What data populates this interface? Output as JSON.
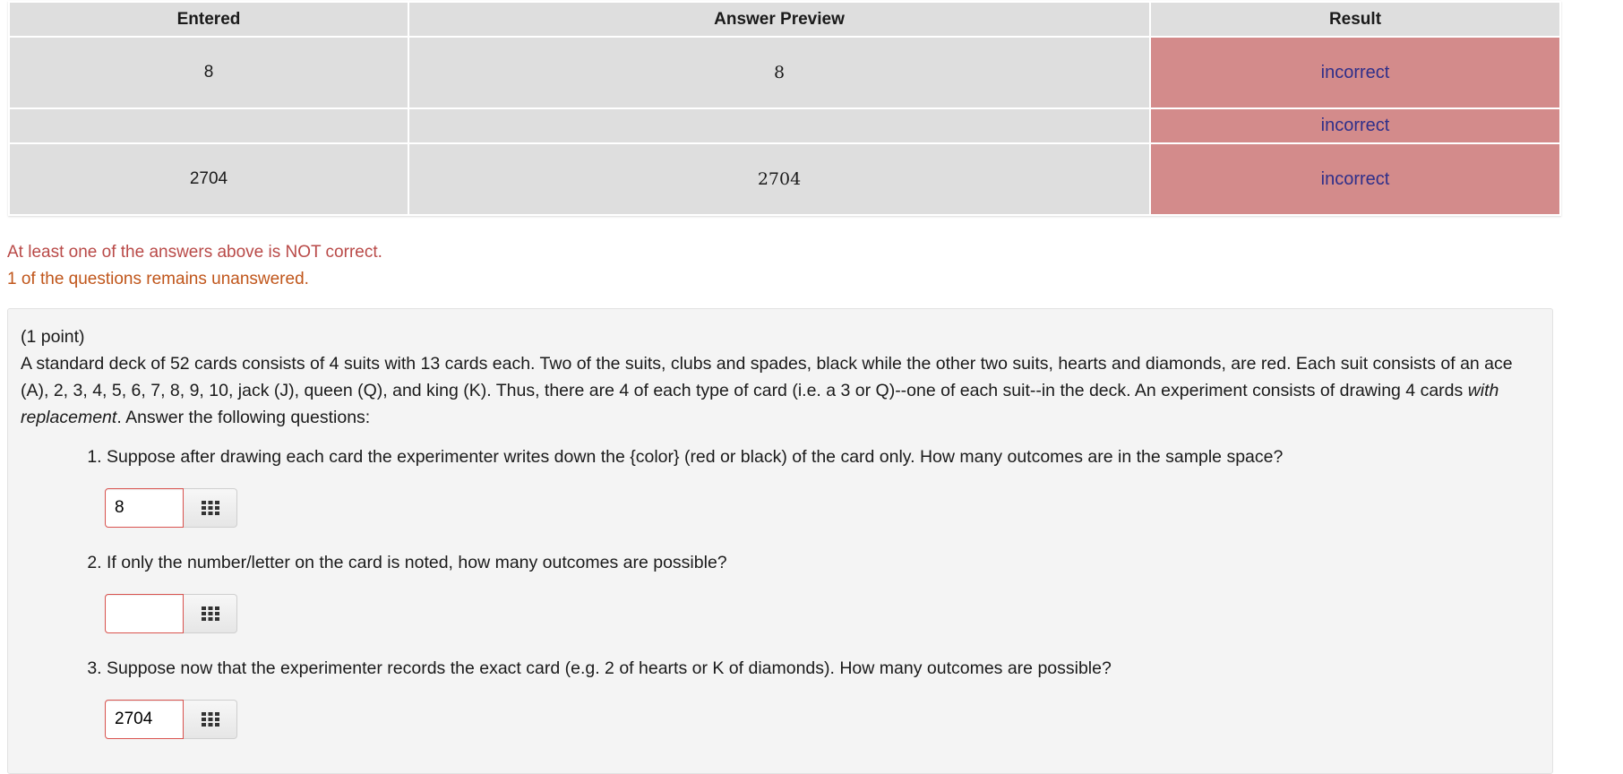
{
  "table": {
    "headers": [
      "Entered",
      "Answer Preview",
      "Result"
    ],
    "rows": [
      {
        "entered": "8",
        "preview": "8",
        "result": "incorrect"
      },
      {
        "entered": "",
        "preview": "",
        "result": "incorrect"
      },
      {
        "entered": "2704",
        "preview": "2704",
        "result": "incorrect"
      }
    ]
  },
  "messages": {
    "error": "At least one of the answers above is NOT correct.",
    "warning": "1 of the questions remains unanswered."
  },
  "problem": {
    "points": "(1 point)",
    "intro_before_em": "A standard deck of 52 cards consists of 4 suits with 13 cards each. Two of the suits, clubs and spades, black while the other two suits, hearts and diamonds, are red. Each suit consists of an ace (A), 2, 3, 4, 5, 6, 7, 8, 9, 10, jack (J), queen (Q), and king (K). Thus, there are 4 of each type of card (i.e. a 3 or Q)--one of each suit--in the deck. An experiment consists of drawing 4 cards ",
    "intro_em": "with replacement",
    "intro_after_em": ". Answer the following questions:",
    "questions": [
      {
        "text": "Suppose after drawing each card the experimenter writes down the {color} (red or black) of the card only. How many outcomes are in the sample space?",
        "value": "8"
      },
      {
        "text": "If only the number/letter on the card is noted, how many outcomes are possible?",
        "value": ""
      },
      {
        "text": "Suppose now that the experimenter records the exact card (e.g. 2 of hearts or K of diamonds). How many outcomes are possible?",
        "value": "2704"
      }
    ]
  },
  "colors": {
    "result_incorrect_bg": "#d38b8b",
    "error_text": "#b94a48",
    "warning_text": "#c0561b"
  },
  "icons": {
    "toolbar": "grid-keypad-icon"
  }
}
